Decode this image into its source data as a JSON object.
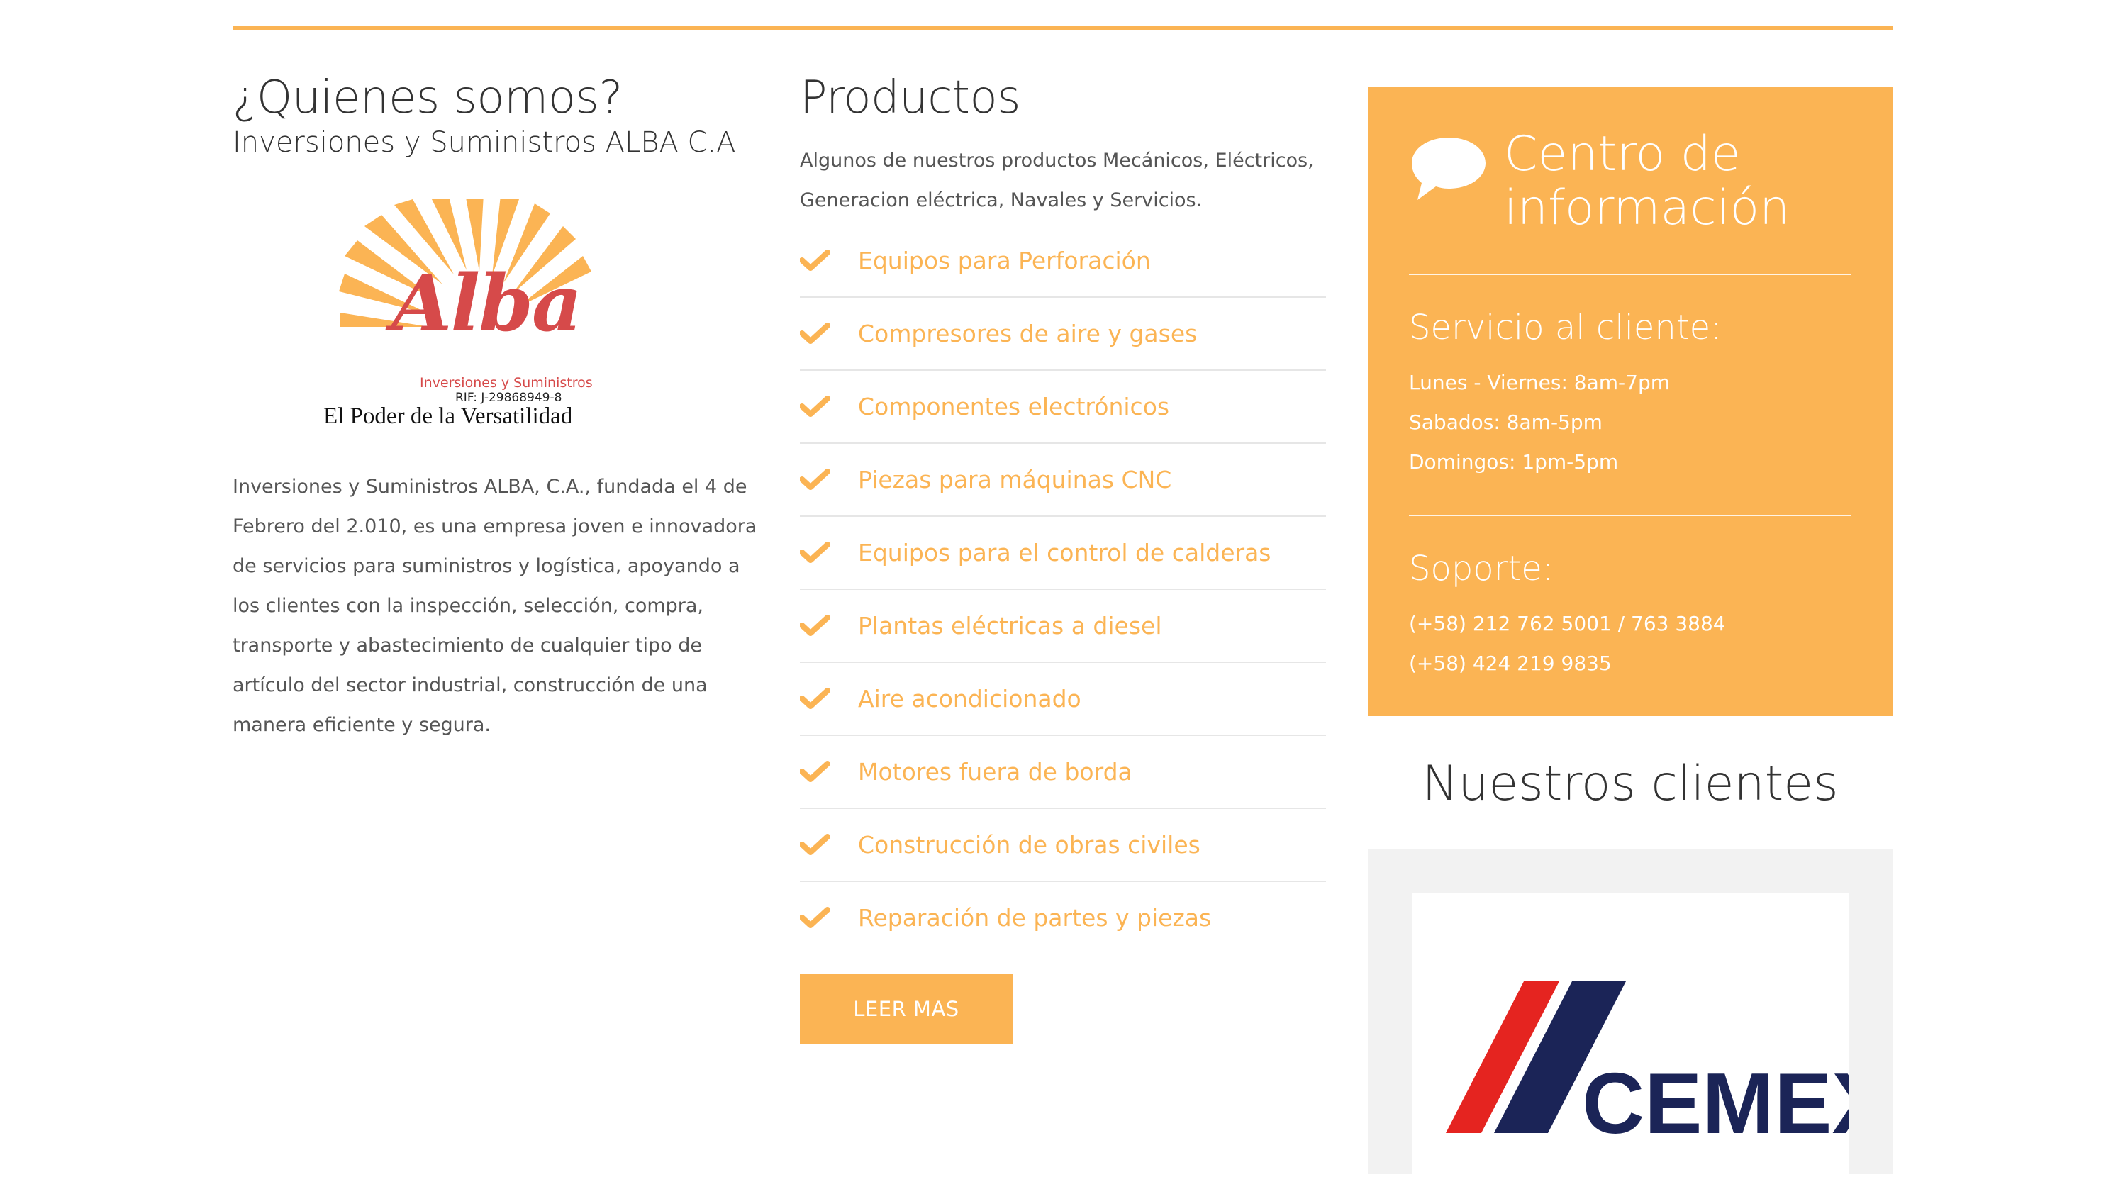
{
  "colors": {
    "accent": "#fbb454",
    "text": "#333333",
    "muted": "#555555"
  },
  "about": {
    "title": "¿Quienes somos?",
    "subtitle": "Inversiones y Suministros ALBA C.A",
    "logo": {
      "name": "Alba",
      "tagline": "Inversiones y Suministros",
      "rif": "RIF: J-29868949-8",
      "slogan": "El Poder de la Versatilidad"
    },
    "body": "Inversiones y Suministros ALBA, C.A., fundada el 4 de Febrero del 2.010, es una empresa joven e innovadora de servicios para suministros y logística, apoyando a los clientes con la inspección, selección, compra, transporte y abastecimiento de cualquier tipo de artículo del sector industrial, construcción de una manera eficiente y segura."
  },
  "products": {
    "title": "Productos",
    "intro": "Algunos de nuestros productos Mecánicos, Eléctricos, Generacion eléctrica, Navales y Servicios.",
    "items": [
      "Equipos para Perforación",
      "Compresores de aire y gases",
      "Componentes electrónicos",
      "Piezas para máquinas CNC",
      "Equipos para el control de calderas",
      "Plantas eléctricas a diesel",
      "Aire acondicionado",
      "Motores fuera de borda",
      "Construcción de obras civiles",
      "Reparación de partes y piezas"
    ],
    "button": "LEER MAS",
    "check_icon": "check-icon"
  },
  "info": {
    "icon": "speech-bubble-icon",
    "title_line1": "Centro de",
    "title_line2": "información",
    "service": {
      "heading": "Servicio al cliente:",
      "lines": [
        "Lunes - Viernes: 8am-7pm",
        "Sabados: 8am-5pm",
        "Domingos: 1pm-5pm"
      ]
    },
    "support": {
      "heading": "Soporte:",
      "lines": [
        "(+58) 212 762 5001 / 763 3884",
        "(+58) 424 219 9835"
      ]
    }
  },
  "clients": {
    "title": "Nuestros clientes",
    "logo_text": "CEMEX"
  }
}
